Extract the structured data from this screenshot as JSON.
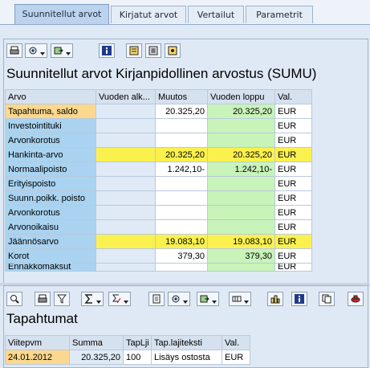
{
  "tabs": [
    "Suunnitellut arvot",
    "Kirjatut arvot",
    "Vertailut",
    "Parametrit"
  ],
  "active_tab": 0,
  "upper": {
    "title": "Suunnitellut arvot Kirjanpidollinen arvostus (SUMU)",
    "columns": [
      "Arvo",
      "Vuoden alk...",
      "Muutos",
      "Vuoden loppu",
      "Val."
    ],
    "rows": [
      {
        "arvo": "Tapahtuma, saldo",
        "alk": "",
        "muutos": "20.325,20",
        "loppu": "20.325,20",
        "val": "EUR",
        "style": "first"
      },
      {
        "arvo": "Investointituki",
        "alk": "",
        "muutos": "",
        "loppu": "",
        "val": "EUR",
        "style": ""
      },
      {
        "arvo": "Arvonkorotus",
        "alk": "",
        "muutos": "",
        "loppu": "",
        "val": "EUR",
        "style": ""
      },
      {
        "arvo": "Hankinta-arvo",
        "alk": "",
        "muutos": "20.325,20",
        "loppu": "20.325,20",
        "val": "EUR",
        "style": "hl"
      },
      {
        "arvo": "Normaalipoisto",
        "alk": "",
        "muutos": "1.242,10-",
        "loppu": "1.242,10-",
        "val": "EUR",
        "style": ""
      },
      {
        "arvo": "Erityispoisto",
        "alk": "",
        "muutos": "",
        "loppu": "",
        "val": "EUR",
        "style": ""
      },
      {
        "arvo": "Suunn.poikk. poisto",
        "alk": "",
        "muutos": "",
        "loppu": "",
        "val": "EUR",
        "style": ""
      },
      {
        "arvo": "Arvonkorotus",
        "alk": "",
        "muutos": "",
        "loppu": "",
        "val": "EUR",
        "style": ""
      },
      {
        "arvo": "Arvonoikaisu",
        "alk": "",
        "muutos": "",
        "loppu": "",
        "val": "EUR",
        "style": ""
      },
      {
        "arvo": "Jäännösarvo",
        "alk": "",
        "muutos": "19.083,10",
        "loppu": "19.083,10",
        "val": "EUR",
        "style": "hl"
      },
      {
        "arvo": "Korot",
        "alk": "",
        "muutos": "379,30",
        "loppu": "379,30",
        "val": "EUR",
        "style": ""
      },
      {
        "arvo": "Ennakkomaksut",
        "alk": "",
        "muutos": "",
        "loppu": "",
        "val": "EUR",
        "style": "cut"
      }
    ]
  },
  "lower": {
    "title": "Tapahtumat",
    "columns": [
      "Viitepvm",
      "Summa",
      "TapLji",
      "Tap.lajiteksti",
      "Val."
    ],
    "rows": [
      {
        "viitepvm": "24.01.2012",
        "summa": "20.325,20",
        "taplji": "100",
        "teksti": "Lisäys ostosta",
        "val": "EUR"
      }
    ]
  },
  "icons": {
    "upper_toolbar": [
      "print-icon",
      "details-icon",
      "export-icon",
      "info-icon",
      "layout-icon",
      "calculator-icon",
      "graphic-icon"
    ],
    "lower_toolbar": [
      "find-icon",
      "print-icon",
      "filter-icon",
      "sum-icon",
      "subtotal-icon",
      "print-preview-icon",
      "details-icon",
      "export-icon",
      "layout-icon",
      "chart-icon",
      "info-icon",
      "copy-icon",
      "abc-icon"
    ]
  },
  "colors": {
    "row_label": "#a9d3f0",
    "row_label_first": "#fbd88d",
    "highlight_row": "#fbf14e",
    "year_end_col": "#c8f3b9"
  }
}
